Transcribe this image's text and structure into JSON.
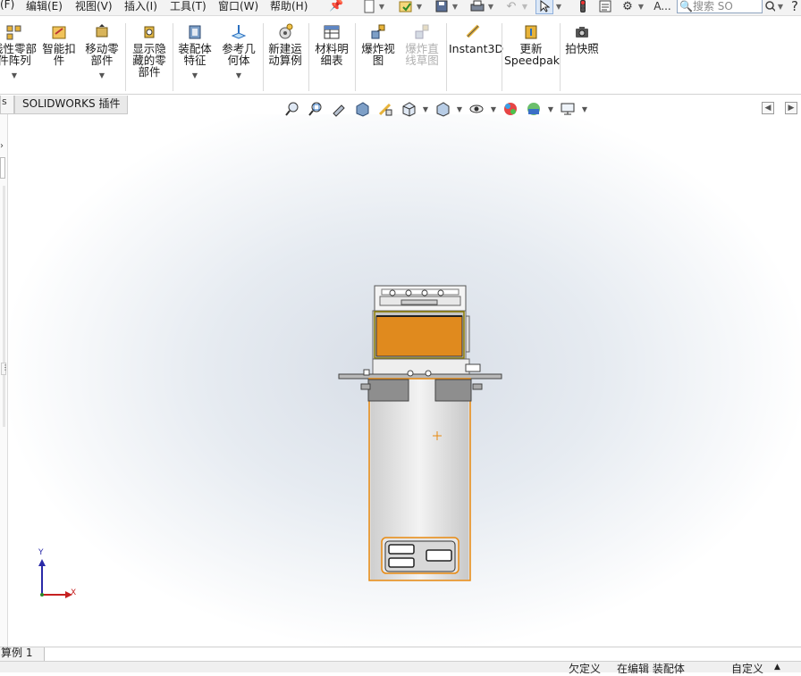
{
  "menubar": {
    "items": [
      {
        "label": "(F)"
      },
      {
        "label": "编辑(E)"
      },
      {
        "label": "视图(V)"
      },
      {
        "label": "插入(I)"
      },
      {
        "label": "工具(T)"
      },
      {
        "label": "窗口(W)"
      },
      {
        "label": "帮助(H)"
      }
    ],
    "search_placeholder": "搜索 SO",
    "overflow_label": "A...",
    "help_label": "?"
  },
  "ribbon": {
    "buttons": [
      {
        "label": "线性零部\n件阵列"
      },
      {
        "label": "智能扣\n件"
      },
      {
        "label": "移动零\n部件"
      },
      {
        "label": "显示隐\n藏的零\n部件"
      },
      {
        "label": "装配体\n特征"
      },
      {
        "label": "参考几\n何体"
      },
      {
        "label": "新建运\n动算例"
      },
      {
        "label": "材料明\n细表"
      },
      {
        "label": "爆炸视\n图"
      },
      {
        "label": "爆炸直\n线草图"
      },
      {
        "label": "Instant3D"
      },
      {
        "label": "更新\nSpeedpak"
      },
      {
        "label": "拍快照"
      }
    ]
  },
  "tabs": {
    "left_partial": "s",
    "active": "SOLIDWORKS 插件"
  },
  "triad": {
    "x_label": "X",
    "y_label": "Y"
  },
  "bottom_tab": "算例 1",
  "status": {
    "underdefined": "欠定义",
    "editing": "在编辑 装配体",
    "custom": "自定义"
  },
  "colors": {
    "accent": "#e08a1e",
    "highlight_orange": "#e8890f",
    "selection_blue": "#2a6fc0"
  }
}
